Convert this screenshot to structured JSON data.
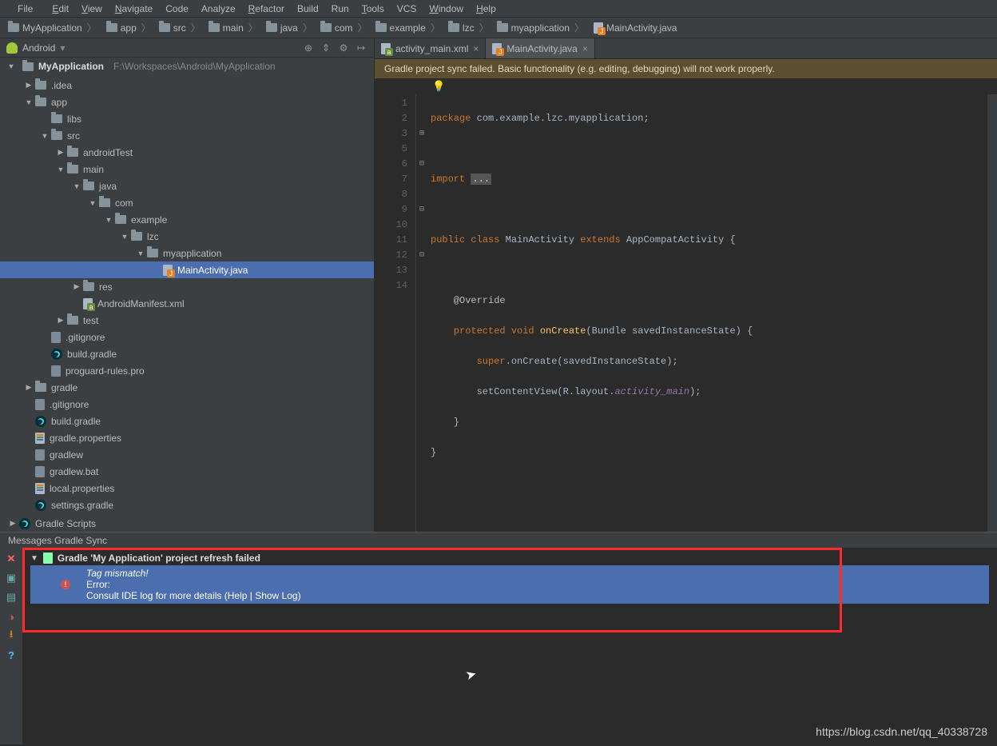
{
  "menubar": {
    "file": "File",
    "edit": "Edit",
    "view": "View",
    "navigate": "Navigate",
    "code": "Code",
    "analyze": "Analyze",
    "refactor": "Refactor",
    "build": "Build",
    "run": "Run",
    "tools": "Tools",
    "vcs": "VCS",
    "window": "Window",
    "help": "Help"
  },
  "breadcrumb": {
    "root": "MyApplication",
    "parts": [
      "app",
      "src",
      "main",
      "java",
      "com",
      "example",
      "lzc",
      "myapplication"
    ],
    "file": "MainActivity.java"
  },
  "projectSelector": {
    "label": "Android"
  },
  "project": {
    "root": "MyApplication",
    "rootPath": "F:\\Workspaces\\Android\\MyApplication",
    "nodes": [
      {
        "depth": 1,
        "caret": "right",
        "icon": "folder",
        "label": ".idea"
      },
      {
        "depth": 1,
        "caret": "down",
        "icon": "folder",
        "label": "app"
      },
      {
        "depth": 2,
        "caret": "",
        "icon": "folder",
        "label": "libs"
      },
      {
        "depth": 2,
        "caret": "down",
        "icon": "folder",
        "label": "src"
      },
      {
        "depth": 3,
        "caret": "right",
        "icon": "folder",
        "label": "androidTest"
      },
      {
        "depth": 3,
        "caret": "down",
        "icon": "folder",
        "label": "main"
      },
      {
        "depth": 4,
        "caret": "down",
        "icon": "folder",
        "label": "java"
      },
      {
        "depth": 5,
        "caret": "down",
        "icon": "folder",
        "label": "com"
      },
      {
        "depth": 6,
        "caret": "down",
        "icon": "folder",
        "label": "example"
      },
      {
        "depth": 7,
        "caret": "down",
        "icon": "folder",
        "label": "lzc"
      },
      {
        "depth": 8,
        "caret": "down",
        "icon": "folder",
        "label": "myapplication"
      },
      {
        "depth": 9,
        "caret": "",
        "icon": "java",
        "label": "MainActivity.java",
        "selected": true
      },
      {
        "depth": 4,
        "caret": "right",
        "icon": "folder",
        "label": "res"
      },
      {
        "depth": 4,
        "caret": "",
        "icon": "xml",
        "label": "AndroidManifest.xml"
      },
      {
        "depth": 3,
        "caret": "right",
        "icon": "folder",
        "label": "test"
      },
      {
        "depth": 2,
        "caret": "",
        "icon": "file",
        "label": ".gitignore"
      },
      {
        "depth": 2,
        "caret": "",
        "icon": "gradle",
        "label": "build.gradle"
      },
      {
        "depth": 2,
        "caret": "",
        "icon": "file",
        "label": "proguard-rules.pro"
      },
      {
        "depth": 1,
        "caret": "right",
        "icon": "folder",
        "label": "gradle"
      },
      {
        "depth": 1,
        "caret": "",
        "icon": "file",
        "label": ".gitignore"
      },
      {
        "depth": 1,
        "caret": "",
        "icon": "gradle",
        "label": "build.gradle"
      },
      {
        "depth": 1,
        "caret": "",
        "icon": "prop",
        "label": "gradle.properties"
      },
      {
        "depth": 1,
        "caret": "",
        "icon": "file",
        "label": "gradlew"
      },
      {
        "depth": 1,
        "caret": "",
        "icon": "file",
        "label": "gradlew.bat"
      },
      {
        "depth": 1,
        "caret": "",
        "icon": "prop",
        "label": "local.properties"
      },
      {
        "depth": 1,
        "caret": "",
        "icon": "gradle",
        "label": "settings.gradle"
      }
    ],
    "gradleScripts": "Gradle Scripts"
  },
  "tabs": {
    "tab1": "activity_main.xml",
    "tab2": "MainActivity.java"
  },
  "banner": "Gradle project sync failed. Basic functionality (e.g. editing, debugging) will not work properly.",
  "code": {
    "lineNumbers": [
      "1",
      "2",
      "3",
      "5",
      "6",
      "7",
      "8",
      "9",
      "10",
      "11",
      "12",
      "13",
      "14"
    ],
    "package_kw": "package",
    "package_val": " com.example.lzc.myapplication;",
    "import_kw": "import",
    "import_ellipsis": "...",
    "public": "public ",
    "class": "class ",
    "mainActivity": "MainActivity ",
    "extends": "extends ",
    "appCompat": "AppCompatActivity {",
    "override": "    @Override",
    "protected": "    protected ",
    "void": "void ",
    "onCreateSig": "onCreate(Bundle savedInstanceState) {",
    "super": "        super",
    "superCall": ".onCreate(savedInstanceState);",
    "setContent": "        setContentView(R.layout.",
    "activityMain": "activity_main",
    "closeParen": ");",
    "closeBrace1": "    }",
    "closeBrace2": "}"
  },
  "console": {
    "header": "Messages Gradle Sync",
    "title": "Gradle 'My Application' project refresh failed",
    "tagMismatch": "Tag mismatch!",
    "errorLabel": "Error:",
    "consult": "Consult IDE log for more details (Help | Show Log)"
  },
  "watermark": "https://blog.csdn.net/qq_40338728"
}
